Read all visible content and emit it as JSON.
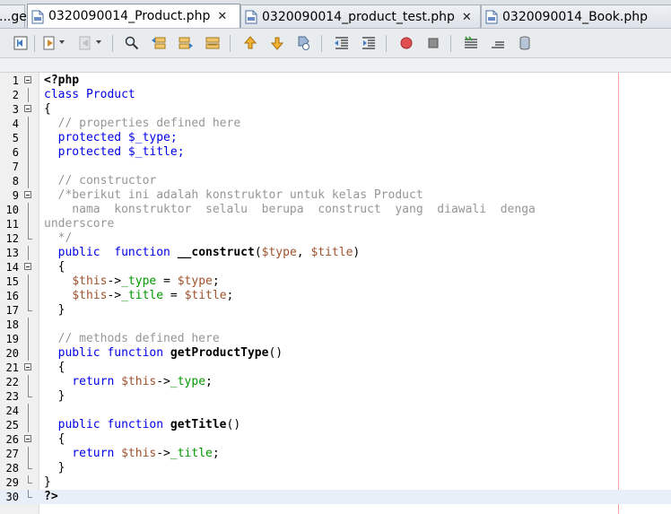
{
  "tabs": [
    {
      "label": "...ge",
      "active": false,
      "closable": false
    },
    {
      "label": "0320090014_Product.php",
      "active": true,
      "closable": true
    },
    {
      "label": "0320090014_product_test.php",
      "active": false,
      "closable": true
    },
    {
      "label": "0320090014_Book.php",
      "active": false,
      "closable": false
    }
  ],
  "close_glyph": "✕",
  "toolbar": [
    "last-edit-icon",
    "back-history-icon",
    "forward-history-icon",
    "find-icon",
    "find-previous-icon",
    "find-next-icon",
    "toggle-highlight-icon",
    "previous-bookmark-icon",
    "next-bookmark-icon",
    "toggle-bookmark-icon",
    "shift-left-icon",
    "shift-right-icon",
    "start-macro-icon",
    "stop-macro-icon",
    "comment-icon",
    "uncomment-icon",
    "database-icon"
  ],
  "code_lines": [
    "<?php",
    "class Product",
    "{",
    "  // properties defined here",
    "  protected $_type;",
    "  protected $_title;",
    "",
    "  // constructor",
    "  /*berikut ini adalah konstruktor untuk kelas Product",
    "    nama  konstruktor  selalu  berupa  construct  yang  diawali  denga",
    "underscore",
    "  */",
    "  public  function __construct($type, $title)",
    "  {",
    "    $this->_type = $type;",
    "    $this->_title = $title;",
    "  }",
    "",
    "  // methods defined here",
    "  public function getProductType()",
    "  {",
    "    return $this->_type;",
    "  }",
    "",
    "  public function getTitle()",
    "  {",
    "    return $this->_title;",
    "  }",
    "}",
    "?>"
  ],
  "line_numbers": [
    "1",
    "2",
    "3",
    "4",
    "5",
    "6",
    "7",
    "8",
    "9",
    "10",
    "11",
    "12",
    "13",
    "14",
    "15",
    "16",
    "17",
    "18",
    "19",
    "20",
    "21",
    "22",
    "23",
    "24",
    "25",
    "26",
    "27",
    "28",
    "29",
    "30"
  ],
  "current_line": 30,
  "colors": {
    "keyword": "#0000e6",
    "variable": "#a0522d",
    "property": "#009900",
    "comment": "#969696",
    "margin_line": "#f3a0a0",
    "current_line_bg": "#e9eff8"
  }
}
